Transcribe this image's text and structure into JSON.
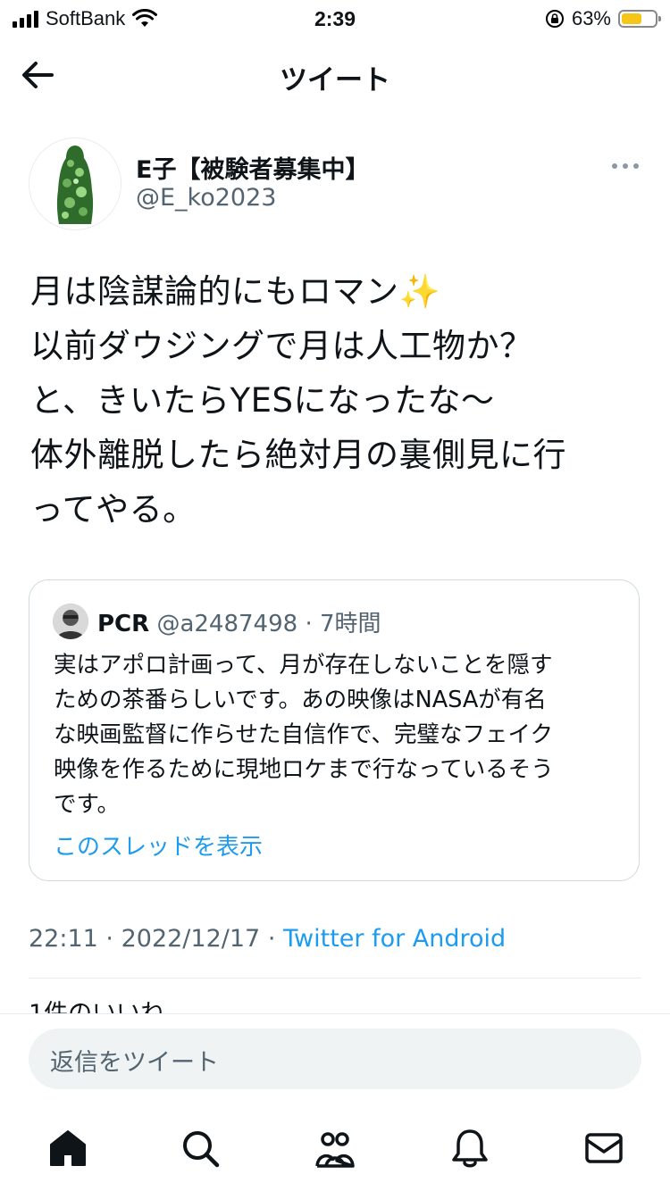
{
  "status_bar": {
    "carrier": "SoftBank",
    "time": "2:39",
    "battery": "63%"
  },
  "header": {
    "title": "ツイート"
  },
  "author": {
    "name": "E子【被験者募集中】",
    "handle": "@E_ko2023"
  },
  "tweet": {
    "text": "月は陰謀論的にもロマン✨\n以前ダウジングで月は人工物か？\nと、きいたらYESになったな〜\n体外離脱したら絶対月の裏側見に行\nってやる。"
  },
  "quote": {
    "name": "PCR",
    "handle": "@a2487498",
    "time": "· 7時間",
    "text": "実はアポロ計画って、月が存在しないことを隠す\nための茶番らしいです。あの映像はNASAが有名\nな映画監督に作らせた自信作で、完璧なフェイク\n映像を作るために現地ロケまで行なっているそう\nです。",
    "show_thread": "このスレッドを表示"
  },
  "meta": {
    "time": "22:11",
    "sep": "·",
    "date": "2022/12/17",
    "source": "Twitter for Android"
  },
  "likes": {
    "text": "1件のいいね"
  },
  "reply": {
    "placeholder": "返信をツイート"
  },
  "tabs": [
    {
      "icon": "home-icon"
    },
    {
      "icon": "search-icon"
    },
    {
      "icon": "communities-icon"
    },
    {
      "icon": "notifications-icon"
    },
    {
      "icon": "messages-icon"
    }
  ],
  "colors": {
    "accent": "#1d9bf0",
    "muted": "#536471",
    "text": "#0f1419"
  }
}
